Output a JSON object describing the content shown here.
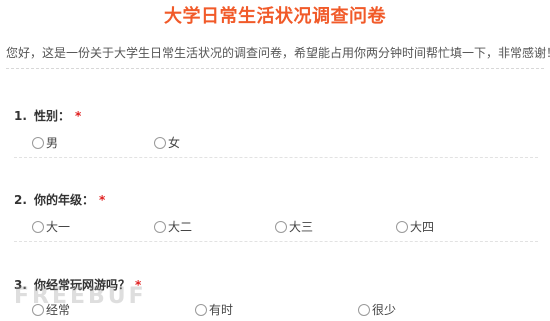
{
  "survey": {
    "title": "大学日常生活状况调查问卷",
    "intro": "您好，这是一份关于大学生日常生活状况的调查问卷，希望能占用你两分钟时间帮忙填一下，非常感谢！"
  },
  "questions": [
    {
      "number": "1.",
      "label": "性别：",
      "required_mark": "*",
      "options": [
        "男",
        "女"
      ]
    },
    {
      "number": "2.",
      "label": "你的年级：",
      "required_mark": "*",
      "options": [
        "大一",
        "大二",
        "大三",
        "大四"
      ]
    },
    {
      "number": "3.",
      "label": "你经常玩网游吗？",
      "required_mark": "*",
      "options": [
        "经常",
        "有时",
        "很少"
      ]
    }
  ],
  "watermark": {
    "text": "FREEBUF"
  },
  "colors": {
    "title": "#f15a29",
    "required": "#e02020"
  }
}
